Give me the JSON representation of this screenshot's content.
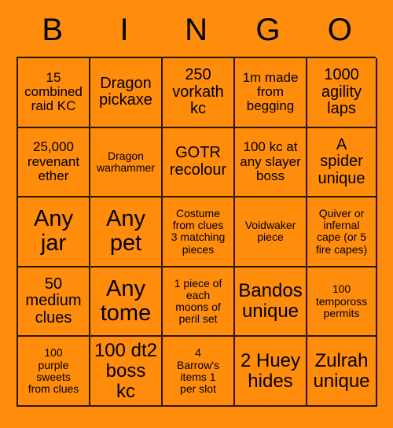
{
  "card": {
    "background_color": "#FF8C0A",
    "border_color": "#2b1500",
    "text_color": "#000000",
    "header_letters": [
      "B",
      "I",
      "N",
      "G",
      "O"
    ],
    "grid": {
      "columns": 5,
      "rows": 5,
      "cells": [
        {
          "text": "15\ncombined\nraid KC",
          "size": "fs-m"
        },
        {
          "text": "Dragon\npickaxe",
          "size": "fs-l"
        },
        {
          "text": "250\nvorkath\nkc",
          "size": "fs-l"
        },
        {
          "text": "1m made\nfrom\nbegging",
          "size": "fs-m"
        },
        {
          "text": "1000\nagility\nlaps",
          "size": "fs-l"
        },
        {
          "text": "25,000\nrevenant\nether",
          "size": "fs-m"
        },
        {
          "text": "Dragon\nwarhammer",
          "size": "fs-s"
        },
        {
          "text": "GOTR\nrecolour",
          "size": "fs-l"
        },
        {
          "text": "100 kc at\nany slayer\nboss",
          "size": "fs-m"
        },
        {
          "text": "A\nspider\nunique",
          "size": "fs-l"
        },
        {
          "text": "Any\njar",
          "size": "fs-xxl"
        },
        {
          "text": "Any\npet",
          "size": "fs-xxl"
        },
        {
          "text": "Costume\nfrom clues\n3 matching\npieces",
          "size": "fs-s"
        },
        {
          "text": "Voidwaker\npiece",
          "size": "fs-s"
        },
        {
          "text": "Quiver or\ninfernal\ncape (or 5\nfire capes)",
          "size": "fs-s"
        },
        {
          "text": "50\nmedium\nclues",
          "size": "fs-l"
        },
        {
          "text": "Any\ntome",
          "size": "fs-xxl"
        },
        {
          "text": "1 piece of\neach\nmoons of\nperil set",
          "size": "fs-s"
        },
        {
          "text": "Bandos\nunique",
          "size": "fs-xl"
        },
        {
          "text": "100\ntempoross\npermits",
          "size": "fs-s"
        },
        {
          "text": "100\npurple\nsweets\nfrom clues",
          "size": "fs-s"
        },
        {
          "text": "100 dt2\nboss\nkc",
          "size": "fs-xl"
        },
        {
          "text": "4\nBarrow's\nitems 1\nper slot",
          "size": "fs-s"
        },
        {
          "text": "2 Huey\nhides",
          "size": "fs-xl"
        },
        {
          "text": "Zulrah\nunique",
          "size": "fs-xl"
        }
      ]
    }
  }
}
